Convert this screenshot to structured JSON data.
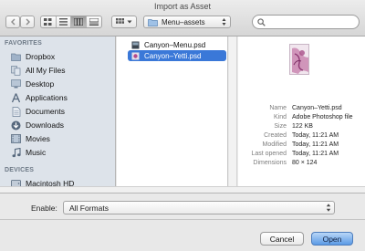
{
  "window": {
    "title": "Import as Asset"
  },
  "toolbar": {
    "back_icon": "chevron-left-icon",
    "forward_icon": "chevron-right-icon",
    "view_modes": [
      "icon-view",
      "list-view",
      "column-view",
      "coverflow-view"
    ],
    "active_view": "column-view",
    "arrange_icon": "grid-icon",
    "path_folder": "Menu–assets",
    "search_placeholder": "",
    "search_value": ""
  },
  "sidebar": {
    "favorites_header": "FAVORITES",
    "favorites": [
      {
        "label": "Dropbox",
        "icon": "dropbox-icon"
      },
      {
        "label": "All My Files",
        "icon": "all-files-icon"
      },
      {
        "label": "Desktop",
        "icon": "desktop-icon"
      },
      {
        "label": "Applications",
        "icon": "applications-icon"
      },
      {
        "label": "Documents",
        "icon": "documents-icon"
      },
      {
        "label": "Downloads",
        "icon": "downloads-icon"
      },
      {
        "label": "Movies",
        "icon": "movies-icon"
      },
      {
        "label": "Music",
        "icon": "music-icon"
      }
    ],
    "devices_header": "DEVICES",
    "devices": [
      {
        "label": "Macintosh HD",
        "icon": "hard-drive-icon"
      }
    ]
  },
  "files": [
    {
      "name": "Canyon–Menu.psd",
      "selected": false
    },
    {
      "name": "Canyon–Yetti.psd",
      "selected": true
    }
  ],
  "preview": {
    "thumbnail_icon": "image-thumbnail-icon",
    "rows": [
      {
        "key": "Name",
        "value": "Canyon–Yetti.psd"
      },
      {
        "key": "Kind",
        "value": "Adobe Photoshop file"
      },
      {
        "key": "Size",
        "value": "122 KB"
      },
      {
        "key": "Created",
        "value": "Today, 11:21 AM"
      },
      {
        "key": "Modified",
        "value": "Today, 11:21 AM"
      },
      {
        "key": "Last opened",
        "value": "Today, 11:21 AM"
      },
      {
        "key": "Dimensions",
        "value": "80 × 124"
      }
    ]
  },
  "enable": {
    "label": "Enable:",
    "selected": "All Formats"
  },
  "buttons": {
    "cancel": "Cancel",
    "open": "Open"
  },
  "colors": {
    "selection": "#3a78d8",
    "sidebar_bg": "#dde3ea",
    "primary_button": "#5a9ae6"
  }
}
